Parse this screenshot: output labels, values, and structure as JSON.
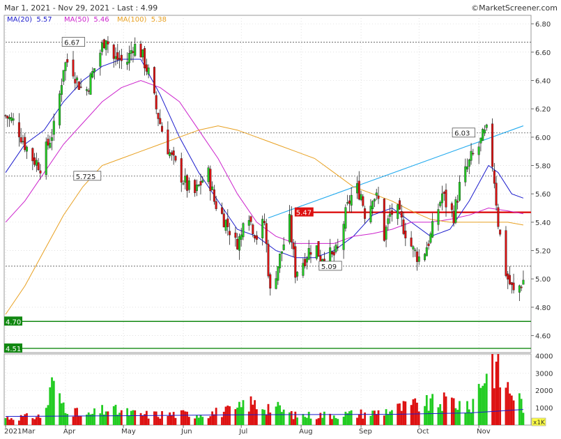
{
  "header": {
    "range_text": "Mar 1, 2021 - Nov 29, 2021 - Last : 4.99",
    "copyright": "©MarketScreener.com",
    "ma_labels": [
      {
        "text": "MA(20)  5.57",
        "color": "#1a1acc"
      },
      {
        "text": "MA(50)  5.46",
        "color": "#cc22cc"
      },
      {
        "text": "MA(100)  5.38",
        "color": "#e8a020"
      }
    ]
  },
  "colors": {
    "up": "#22cc22",
    "down": "#dd1111",
    "ma20": "#1a1acc",
    "ma50": "#cc22cc",
    "ma100": "#e8a020",
    "trend": "#22aaee",
    "resistance": "#dd1111",
    "support": "#118811",
    "grid": "#cccccc"
  },
  "chart_data": [
    {
      "type": "candlestick",
      "title": "",
      "price_axis": {
        "ticks": [
          "4.60",
          "4.80",
          "5.00",
          "5.20",
          "5.40",
          "5.60",
          "5.80",
          "6.00",
          "6.20",
          "6.40",
          "6.60",
          "6.80"
        ],
        "ylim": [
          4.48,
          6.84
        ]
      },
      "x_axis": {
        "labels": [
          {
            "label": "2021Mar",
            "day": 0
          },
          {
            "label": "Apr",
            "day": 31
          },
          {
            "label": "May",
            "day": 61
          },
          {
            "label": "Jun",
            "day": 92
          },
          {
            "label": "Jul",
            "day": 122
          },
          {
            "label": "Aug",
            "day": 153
          },
          {
            "label": "Sep",
            "day": 184
          },
          {
            "label": "Oct",
            "day": 214
          },
          {
            "label": "Nov",
            "day": 245
          }
        ],
        "start_date": "2021-03-01",
        "end_date": "2021-11-29"
      },
      "price_anchors": [
        [
          0,
          6.15
        ],
        [
          5,
          6.1
        ],
        [
          10,
          5.95
        ],
        [
          14,
          5.85
        ],
        [
          18,
          5.8
        ],
        [
          22,
          5.95
        ],
        [
          26,
          6.1
        ],
        [
          30,
          6.5
        ],
        [
          33,
          6.55
        ],
        [
          37,
          6.4
        ],
        [
          41,
          6.3
        ],
        [
          45,
          6.45
        ],
        [
          49,
          6.6
        ],
        [
          52,
          6.72
        ],
        [
          55,
          6.55
        ],
        [
          59,
          6.55
        ],
        [
          62,
          6.5
        ],
        [
          66,
          6.65
        ],
        [
          70,
          6.6
        ],
        [
          74,
          6.45
        ],
        [
          78,
          6.2
        ],
        [
          82,
          6.0
        ],
        [
          86,
          5.85
        ],
        [
          90,
          5.75
        ],
        [
          94,
          5.65
        ],
        [
          98,
          5.6
        ],
        [
          102,
          5.7
        ],
        [
          104,
          5.8
        ],
        [
          108,
          5.55
        ],
        [
          112,
          5.45
        ],
        [
          116,
          5.35
        ],
        [
          119,
          5.25
        ],
        [
          122,
          5.3
        ],
        [
          124,
          5.6
        ],
        [
          127,
          5.4
        ],
        [
          130,
          5.3
        ],
        [
          134,
          5.4
        ],
        [
          137,
          4.9
        ],
        [
          140,
          5.05
        ],
        [
          144,
          5.25
        ],
        [
          147,
          5.4
        ],
        [
          150,
          5.05
        ],
        [
          153,
          5.1
        ],
        [
          157,
          5.2
        ],
        [
          160,
          5.25
        ],
        [
          163,
          5.15
        ],
        [
          166,
          5.2
        ],
        [
          169,
          5.15
        ],
        [
          172,
          5.2
        ],
        [
          175,
          5.4
        ],
        [
          178,
          5.55
        ],
        [
          181,
          5.65
        ],
        [
          184,
          5.6
        ],
        [
          187,
          5.4
        ],
        [
          190,
          5.6
        ],
        [
          193,
          5.55
        ],
        [
          196,
          5.3
        ],
        [
          199,
          5.45
        ],
        [
          202,
          5.5
        ],
        [
          205,
          5.4
        ],
        [
          208,
          5.3
        ],
        [
          211,
          5.2
        ],
        [
          214,
          5.15
        ],
        [
          217,
          5.2
        ],
        [
          220,
          5.3
        ],
        [
          223,
          5.45
        ],
        [
          226,
          5.6
        ],
        [
          229,
          5.5
        ],
        [
          232,
          5.45
        ],
        [
          235,
          5.65
        ],
        [
          238,
          5.75
        ],
        [
          241,
          5.85
        ],
        [
          244,
          5.9
        ],
        [
          247,
          6.0
        ],
        [
          250,
          6.05
        ],
        [
          253,
          5.7
        ],
        [
          255,
          5.4
        ],
        [
          258,
          5.1
        ],
        [
          260,
          5.0
        ],
        [
          263,
          4.9
        ],
        [
          266,
          4.95
        ],
        [
          268,
          4.99
        ]
      ],
      "moving_averages": [
        {
          "name": "MA(20)",
          "last": 5.57,
          "color": "#1a1acc",
          "points": [
            [
              0,
              5.75
            ],
            [
              10,
              5.95
            ],
            [
              20,
              6.05
            ],
            [
              30,
              6.25
            ],
            [
              40,
              6.4
            ],
            [
              50,
              6.5
            ],
            [
              60,
              6.55
            ],
            [
              70,
              6.55
            ],
            [
              80,
              6.3
            ],
            [
              90,
              6.0
            ],
            [
              100,
              5.75
            ],
            [
              110,
              5.55
            ],
            [
              120,
              5.35
            ],
            [
              130,
              5.3
            ],
            [
              140,
              5.2
            ],
            [
              150,
              5.15
            ],
            [
              160,
              5.15
            ],
            [
              170,
              5.2
            ],
            [
              180,
              5.3
            ],
            [
              190,
              5.45
            ],
            [
              200,
              5.5
            ],
            [
              210,
              5.4
            ],
            [
              220,
              5.3
            ],
            [
              230,
              5.35
            ],
            [
              240,
              5.55
            ],
            [
              250,
              5.8
            ],
            [
              255,
              5.75
            ],
            [
              262,
              5.6
            ],
            [
              268,
              5.57
            ]
          ]
        },
        {
          "name": "MA(50)",
          "last": 5.46,
          "color": "#cc22cc",
          "points": [
            [
              0,
              5.4
            ],
            [
              10,
              5.55
            ],
            [
              20,
              5.75
            ],
            [
              30,
              5.95
            ],
            [
              40,
              6.1
            ],
            [
              50,
              6.25
            ],
            [
              60,
              6.35
            ],
            [
              70,
              6.4
            ],
            [
              80,
              6.35
            ],
            [
              90,
              6.25
            ],
            [
              100,
              6.05
            ],
            [
              110,
              5.85
            ],
            [
              120,
              5.6
            ],
            [
              130,
              5.4
            ],
            [
              140,
              5.3
            ],
            [
              150,
              5.25
            ],
            [
              160,
              5.25
            ],
            [
              170,
              5.25
            ],
            [
              180,
              5.3
            ],
            [
              190,
              5.32
            ],
            [
              200,
              5.35
            ],
            [
              210,
              5.4
            ],
            [
              220,
              5.4
            ],
            [
              230,
              5.42
            ],
            [
              240,
              5.45
            ],
            [
              250,
              5.5
            ],
            [
              260,
              5.48
            ],
            [
              268,
              5.46
            ]
          ]
        },
        {
          "name": "MA(100)",
          "last": 5.38,
          "color": "#e8a020",
          "points": [
            [
              0,
              4.75
            ],
            [
              10,
              4.95
            ],
            [
              20,
              5.2
            ],
            [
              30,
              5.45
            ],
            [
              40,
              5.65
            ],
            [
              50,
              5.8
            ],
            [
              60,
              5.85
            ],
            [
              70,
              5.9
            ],
            [
              80,
              5.95
            ],
            [
              90,
              6.0
            ],
            [
              100,
              6.05
            ],
            [
              110,
              6.08
            ],
            [
              120,
              6.05
            ],
            [
              130,
              6.0
            ],
            [
              140,
              5.95
            ],
            [
              150,
              5.9
            ],
            [
              160,
              5.85
            ],
            [
              170,
              5.75
            ],
            [
              180,
              5.65
            ],
            [
              190,
              5.6
            ],
            [
              200,
              5.55
            ],
            [
              210,
              5.48
            ],
            [
              220,
              5.42
            ],
            [
              230,
              5.4
            ],
            [
              240,
              5.4
            ],
            [
              250,
              5.4
            ],
            [
              260,
              5.4
            ],
            [
              268,
              5.38
            ]
          ]
        }
      ],
      "levels": [
        {
          "label": "6.67",
          "value": 6.67,
          "style": "dotted"
        },
        {
          "label": "6.03",
          "value": 6.03,
          "style": "dotted"
        },
        {
          "label": "5.725",
          "value": 5.725,
          "style": "dotted"
        },
        {
          "label": "5.09",
          "value": 5.09,
          "style": "dotted"
        },
        {
          "label": "5.47",
          "value": 5.47,
          "style": "resistance"
        },
        {
          "label": "4.70",
          "value": 4.7,
          "style": "support"
        },
        {
          "label": "4.51",
          "value": 4.51,
          "style": "support"
        }
      ],
      "trendline": {
        "from": [
          136,
          5.43
        ],
        "to": [
          268,
          6.08
        ]
      }
    },
    {
      "type": "bar",
      "title": "",
      "unit_label": "x1K",
      "volume_axis": {
        "ticks": [
          "1000",
          "2000",
          "3000",
          "4000"
        ],
        "ylim": [
          0,
          4100
        ]
      },
      "volume_anchors": [
        [
          0,
          420
        ],
        [
          20,
          520
        ],
        [
          25,
          2700
        ],
        [
          27,
          1500
        ],
        [
          40,
          450
        ],
        [
          52,
          900
        ],
        [
          70,
          600
        ],
        [
          100,
          650
        ],
        [
          120,
          850
        ],
        [
          124,
          1300
        ],
        [
          140,
          1000
        ],
        [
          150,
          550
        ],
        [
          170,
          600
        ],
        [
          190,
          700
        ],
        [
          210,
          1100
        ],
        [
          218,
          1200
        ],
        [
          232,
          1400
        ],
        [
          240,
          900
        ],
        [
          252,
          4100
        ],
        [
          254,
          3300
        ],
        [
          258,
          2300
        ],
        [
          262,
          2000
        ],
        [
          268,
          1200
        ]
      ],
      "volume_ma": [
        [
          0,
          500
        ],
        [
          60,
          540
        ],
        [
          130,
          600
        ],
        [
          200,
          620
        ],
        [
          240,
          700
        ],
        [
          268,
          900
        ]
      ]
    }
  ]
}
